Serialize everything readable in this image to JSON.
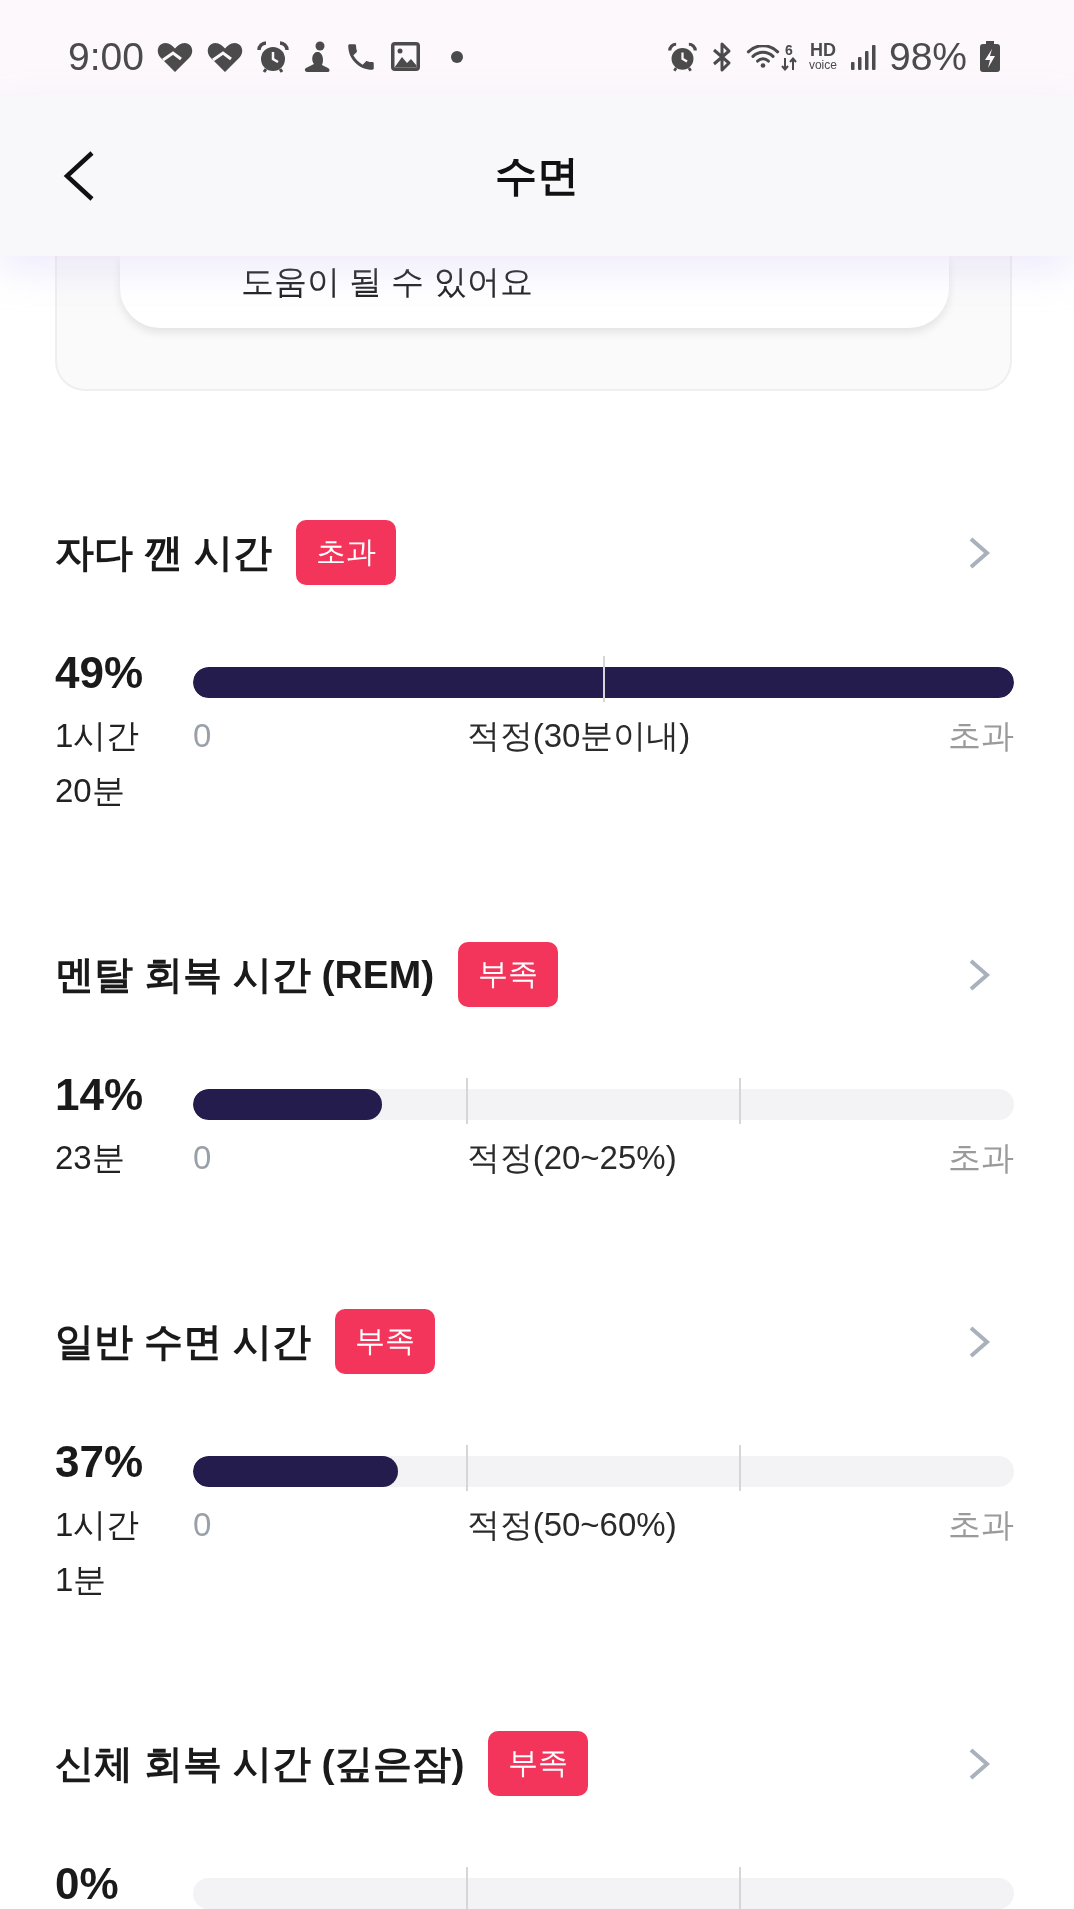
{
  "status_bar": {
    "time": "9:00",
    "wifi_badge": "6",
    "hd_voice": [
      "HD",
      "voice"
    ],
    "battery": "98%"
  },
  "header": {
    "title": "수면"
  },
  "tip_card": {
    "text": "도움이 될 수 있어요"
  },
  "metrics": [
    {
      "title": "자다 깬 시간",
      "status": "초과",
      "percent": "49%",
      "duration": "1시간 20분",
      "kind": "limit",
      "level": 1,
      "scale": {
        "min": "0",
        "target": "적정(30분이내)",
        "max": "초과"
      }
    },
    {
      "title": "멘탈 회복 시간 (REM)",
      "status": "부족",
      "percent": "14%",
      "duration": "23분",
      "kind": "range",
      "level": 0.23,
      "scale": {
        "min": "0",
        "target": "적정(20~25%)",
        "max": "초과"
      }
    },
    {
      "title": "일반 수면 시간",
      "status": "부족",
      "percent": "37%",
      "duration": "1시간 1분",
      "kind": "range",
      "level": 0.25,
      "scale": {
        "min": "0",
        "target": "적정(50~60%)",
        "max": "초과"
      }
    },
    {
      "title": "신체 회복 시간 (깊은잠)",
      "status": "부족",
      "percent": "0%",
      "kind": "range",
      "level": 0
    }
  ]
}
